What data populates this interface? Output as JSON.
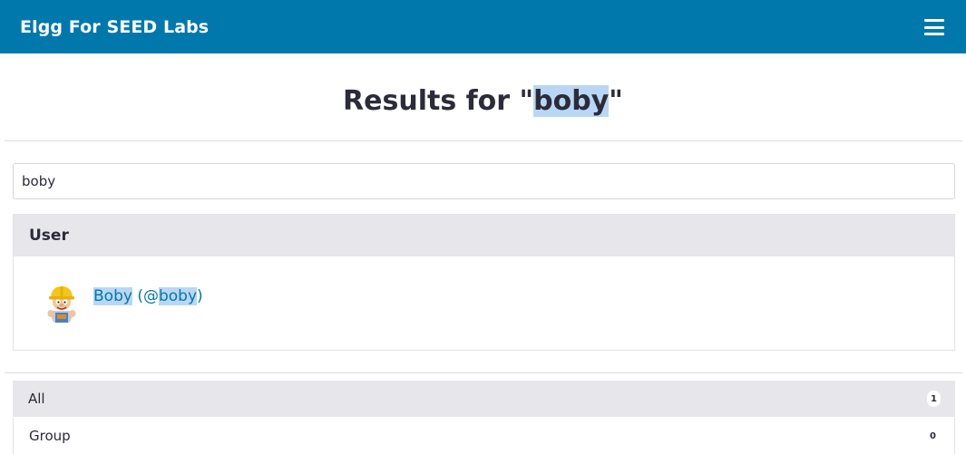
{
  "topbar": {
    "site_name": "Elgg For SEED Labs",
    "menu_icon": "hamburger-menu-icon",
    "bg_color": "#0078ac"
  },
  "page": {
    "title_prefix": "Results for \"",
    "query": "boby",
    "title_suffix": "\""
  },
  "search": {
    "value": "boby"
  },
  "results": {
    "section_title": "User",
    "users": [
      {
        "name": "Boby",
        "handle_prefix": " (@",
        "handle": "boby",
        "handle_suffix": ")",
        "avatar_icon": "user-avatar-builder-icon"
      }
    ]
  },
  "filters": [
    {
      "label": "All",
      "count": "1",
      "selected": true
    },
    {
      "label": "Group",
      "count": "0",
      "selected": false
    }
  ],
  "colors": {
    "link": "#0078ac",
    "highlight": "#b9d7f4",
    "panel": "#e7e6eb"
  }
}
